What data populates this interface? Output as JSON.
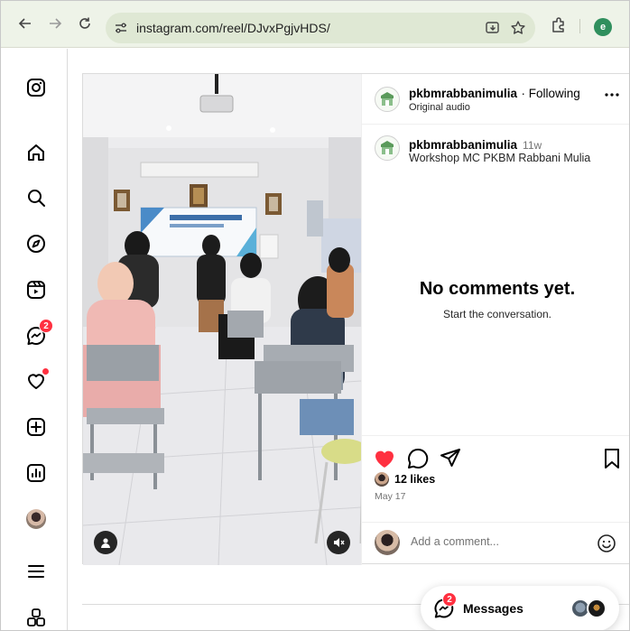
{
  "browser": {
    "url": "instagram.com/reel/DJvxPgjvHDS/",
    "profile_initial": "e"
  },
  "sidebar": {
    "notifications_badge": "2"
  },
  "post": {
    "username": "pkbmrabbanimulia",
    "following_label": "· Following",
    "audio_label": "Original audio",
    "caption_user": "pkbmrabbanimulia",
    "caption_time": "11w",
    "caption_text": "Workshop MC PKBM Rabbani Mulia",
    "empty_title": "No comments yet.",
    "empty_subtitle": "Start the conversation.",
    "likes": "12 likes",
    "date": "May 17",
    "comment_placeholder": "Add a comment..."
  },
  "messages": {
    "label": "Messages",
    "badge": "2"
  },
  "colors": {
    "like_red": "#ff3040",
    "chrome_bg": "#eef3e8",
    "profile_green": "#2f8f5d"
  }
}
